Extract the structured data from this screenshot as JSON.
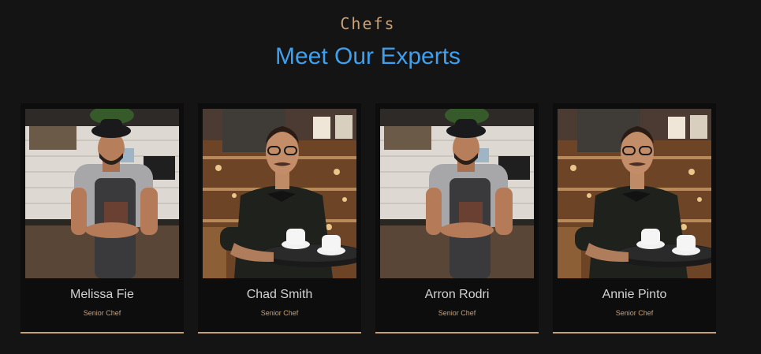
{
  "section": {
    "eyebrow": "Chefs",
    "title": "Meet Our Experts"
  },
  "team": [
    {
      "name": "Melissa Fie",
      "role": "Senior Chef",
      "photo": "barista-apron-bar"
    },
    {
      "name": "Chad Smith",
      "role": "Senior Chef",
      "photo": "waiter-coffee-tray"
    },
    {
      "name": "Arron Rodri",
      "role": "Senior Chef",
      "photo": "barista-apron-bar"
    },
    {
      "name": "Annie Pinto",
      "role": "Senior Chef",
      "photo": "waiter-coffee-tray"
    }
  ],
  "colors": {
    "background": "#141414",
    "card": "#0d0d0d",
    "accent": "#c8a07a",
    "title": "#3ea0ee"
  }
}
